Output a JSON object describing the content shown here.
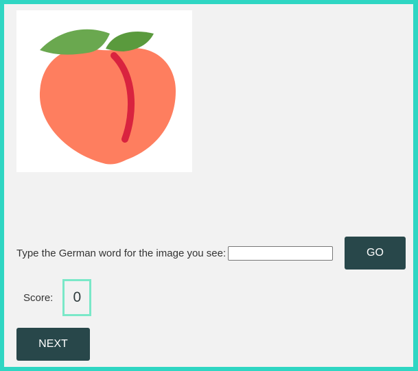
{
  "quiz": {
    "image_icon": "peach-icon",
    "prompt": "Type the German word for the image you see:",
    "answer_value": "",
    "go_label": "GO",
    "score_label": "Score:",
    "score_value": "0",
    "next_label": "NEXT"
  },
  "colors": {
    "outer_border": "#2fd6c3",
    "background": "#f2f2f2",
    "button": "#28474a",
    "score_border": "#7ae8c8",
    "peach_body": "#fe7e5f",
    "peach_crease": "#d9233f",
    "leaf": "#6aa84f"
  }
}
